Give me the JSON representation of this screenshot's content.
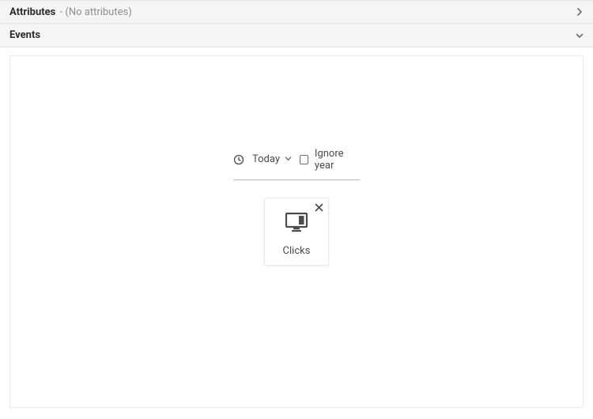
{
  "sections": {
    "attributes": {
      "title": "Attributes",
      "subtitle": "- (No attributes)",
      "expanded": false
    },
    "events": {
      "title": "Events",
      "expanded": true,
      "controls": {
        "date_range_label": "Today",
        "ignore_year_label": "Ignore year",
        "ignore_year_checked": false
      },
      "card": {
        "label": "Clicks"
      }
    }
  }
}
